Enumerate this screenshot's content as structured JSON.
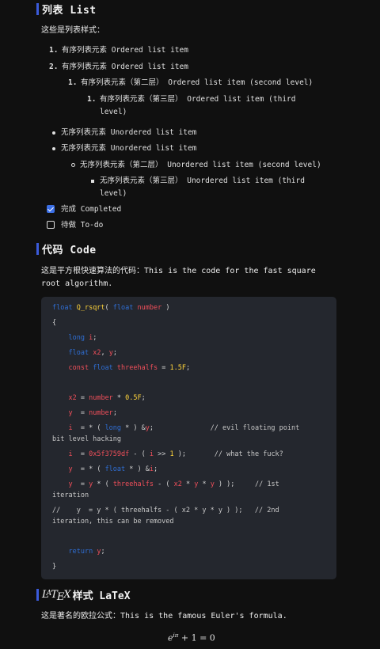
{
  "list_section": {
    "title": "列表 List",
    "intro": "这些是列表样式：",
    "ordered": [
      {
        "num": "1.",
        "text": "有序列表元素 Ordered list item"
      },
      {
        "num": "2.",
        "text": "有序列表元素 Ordered list item"
      },
      {
        "num": "1.",
        "text": "有序列表元素（第二层） Ordered list item (second level)"
      },
      {
        "num": "1.",
        "text_line1": "有序列表元素（第三层） Ordered list item (third",
        "text_line2": "level)"
      }
    ],
    "unordered": [
      {
        "text": "无序列表元素 Unordered list item"
      },
      {
        "text": "无序列表元素 Unordered list item"
      },
      {
        "text": "无序列表元素（第二层） Unordered list item (second level)"
      },
      {
        "text_line1": "无序列表元素（第三层） Unordered list item (third",
        "text_line2": "level)"
      }
    ],
    "tasks": [
      {
        "label": "完成 Completed",
        "checked": true
      },
      {
        "label": "待做 To-do",
        "checked": false
      }
    ]
  },
  "code_section": {
    "title": "代码 Code",
    "intro_line1": "这是平方根快速算法的代码：This is the code for the fast square",
    "intro_line2": "root algorithm.",
    "comments": {
      "c1a": "// evil floating point",
      "c1b": "bit level hacking",
      "c2": "// what the fuck?",
      "c3a": "// 1st",
      "c3b": "iteration",
      "c4a": "//    y  = y * ( threehalfs - ( x2 * y * y ) );   // 2nd",
      "c4b": "iteration, this can be removed"
    }
  },
  "latex_section": {
    "logo_text": "LaTeX",
    "title_suffix": "样式 LaTeX",
    "intro": "这是著名的欧拉公式：This is the famous Euler's formula.",
    "formula_base": "e",
    "formula_exp": "iπ",
    "formula_rest": " + 1 = 0"
  },
  "colors": {
    "background": "#101010",
    "accent_bar": "#3b5bdb",
    "code_background": "#24272e",
    "keyword": "#2f6fd6",
    "identifier": "#f04f5a",
    "number": "#ffd43b",
    "checkbox": "#3b6fe6"
  }
}
